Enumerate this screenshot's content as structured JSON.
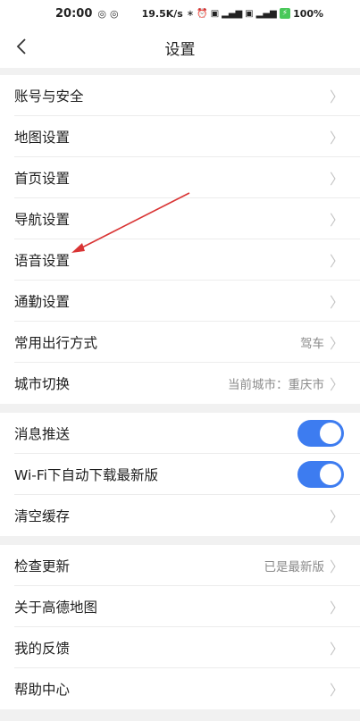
{
  "status_bar": {
    "time": "20:00",
    "speed": "19.5K/s",
    "battery": "100%",
    "battery_level_label": "⚡"
  },
  "header": {
    "title": "设置",
    "back_icon": "chevron-left-icon"
  },
  "group1": [
    {
      "label": "账号与安全",
      "value": ""
    },
    {
      "label": "地图设置",
      "value": ""
    },
    {
      "label": "首页设置",
      "value": ""
    },
    {
      "label": "导航设置",
      "value": ""
    },
    {
      "label": "语音设置",
      "value": ""
    },
    {
      "label": "通勤设置",
      "value": ""
    },
    {
      "label": "常用出行方式",
      "value": "驾车"
    },
    {
      "label": "城市切换",
      "value": "当前城市：重庆市"
    }
  ],
  "group2": [
    {
      "label": "消息推送",
      "toggle": true
    },
    {
      "label": "Wi-Fi下自动下载最新版",
      "toggle": true
    },
    {
      "label": "清空缓存",
      "value": ""
    }
  ],
  "group3": [
    {
      "label": "检查更新",
      "value": "已是最新版"
    },
    {
      "label": "关于高德地图",
      "value": ""
    },
    {
      "label": "我的反馈",
      "value": ""
    },
    {
      "label": "帮助中心",
      "value": ""
    }
  ],
  "colors": {
    "toggle_on": "#3d7cf0",
    "annotation_arrow": "#d93434"
  }
}
